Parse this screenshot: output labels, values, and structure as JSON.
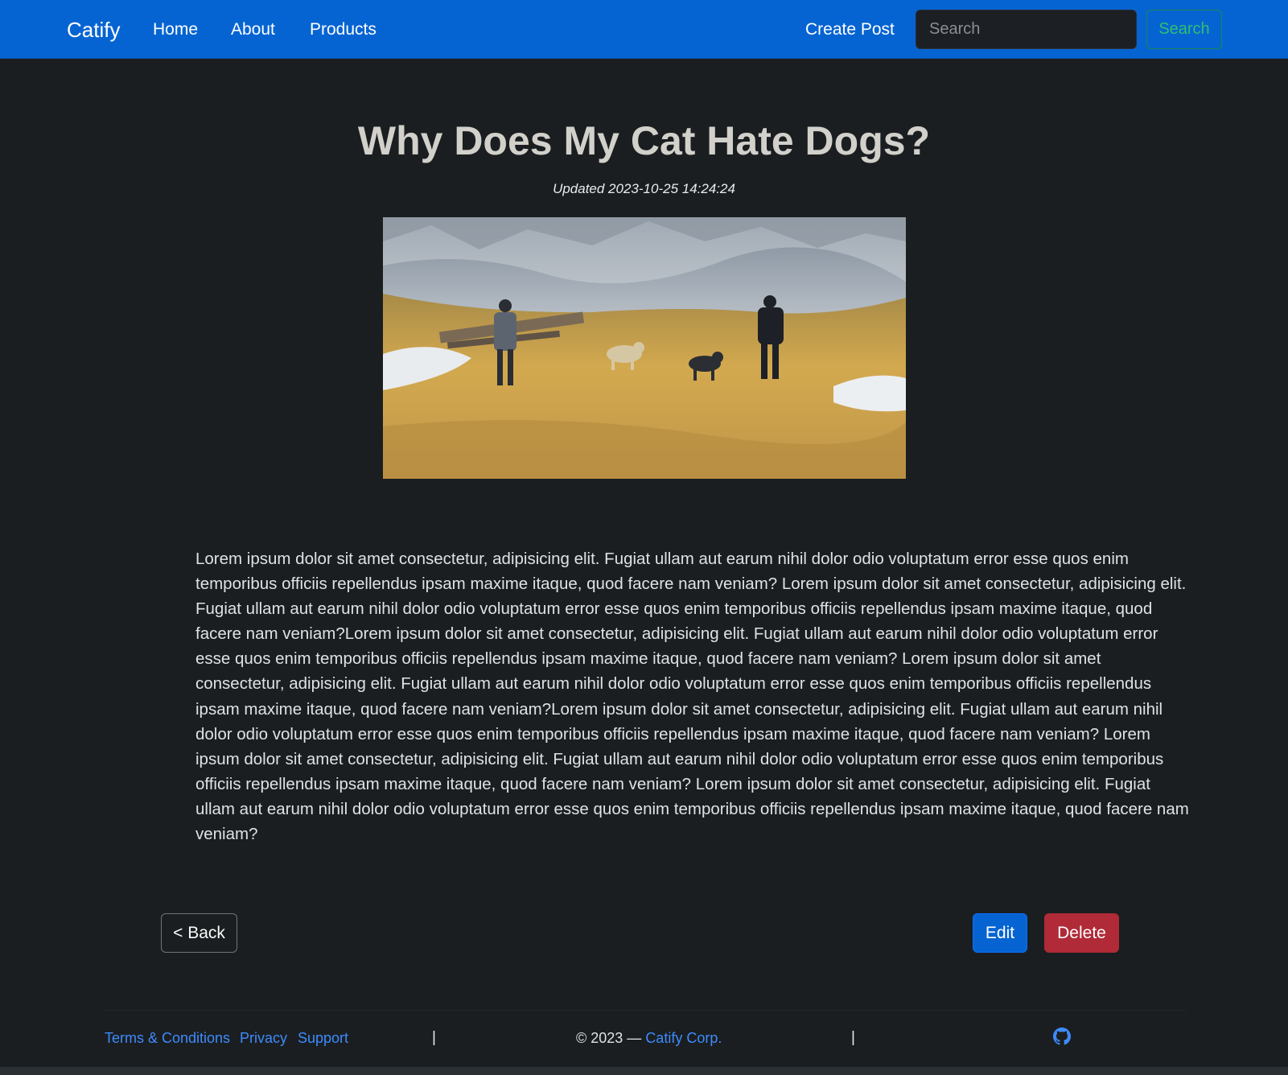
{
  "navbar": {
    "brand": "Catify",
    "links": [
      "Home",
      "About",
      "Products"
    ],
    "create_post": "Create Post",
    "search_placeholder": "Search",
    "search_button": "Search",
    "colors": {
      "background": "#0664d2",
      "search_button": "#198754"
    }
  },
  "post": {
    "title": "Why Does My Cat Hate Dogs?",
    "updated": "Updated 2023-10-25 14:24:24",
    "image_icon": "photo-hikers-with-dogs-on-mountain-meadow",
    "body": "Lorem ipsum dolor sit amet consectetur, adipisicing elit. Fugiat ullam aut earum nihil dolor odio voluptatum error esse quos enim temporibus officiis repellendus ipsam maxime itaque, quod facere nam veniam? Lorem ipsum dolor sit amet consectetur, adipisicing elit. Fugiat ullam aut earum nihil dolor odio voluptatum error esse quos enim temporibus officiis repellendus ipsam maxime itaque, quod facere nam veniam?Lorem ipsum dolor sit amet consectetur, adipisicing elit. Fugiat ullam aut earum nihil dolor odio voluptatum error esse quos enim temporibus officiis repellendus ipsam maxime itaque, quod facere nam veniam? Lorem ipsum dolor sit amet consectetur, adipisicing elit. Fugiat ullam aut earum nihil dolor odio voluptatum error esse quos enim temporibus officiis repellendus ipsam maxime itaque, quod facere nam veniam?Lorem ipsum dolor sit amet consectetur, adipisicing elit. Fugiat ullam aut earum nihil dolor odio voluptatum error esse quos enim temporibus officiis repellendus ipsam maxime itaque, quod facere nam veniam? Lorem ipsum dolor sit amet consectetur, adipisicing elit. Fugiat ullam aut earum nihil dolor odio voluptatum error esse quos enim temporibus officiis repellendus ipsam maxime itaque, quod facere nam veniam? Lorem ipsum dolor sit amet consectetur, adipisicing elit. Fugiat ullam aut earum nihil dolor odio voluptatum error esse quos enim temporibus officiis repellendus ipsam maxime itaque, quod facere nam veniam?"
  },
  "actions": {
    "back": "< Back",
    "edit": "Edit",
    "delete": "Delete",
    "colors": {
      "edit": "#0664d2",
      "delete": "#b02a37"
    }
  },
  "footer": {
    "links": [
      "Terms & Conditions",
      "Privacy",
      "Support"
    ],
    "separator": "|",
    "copyright_prefix": "© 2023 — ",
    "company": "Catify Corp.",
    "icon": "github-icon",
    "link_color": "#3d8bfd"
  }
}
